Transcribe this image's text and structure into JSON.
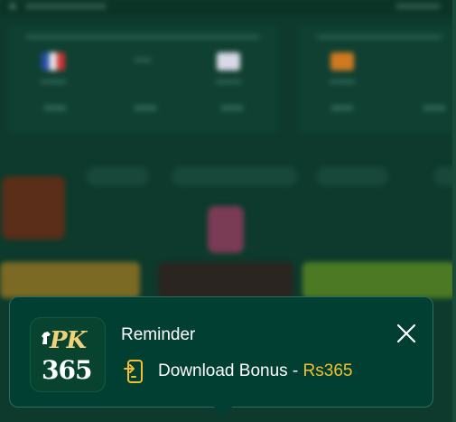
{
  "toast": {
    "title": "Reminder",
    "download_label": "Download Bonus - ",
    "bonus_amount": "Rs365",
    "logo_line1": "PK",
    "logo_line2": "365",
    "close_icon": "close-icon",
    "download_icon": "download-phone-icon"
  },
  "colors": {
    "background": "#0d3a2c",
    "toast_background": "#003f32",
    "accent_gold": "#f0c030",
    "logo_gold": "#f1d27a"
  }
}
